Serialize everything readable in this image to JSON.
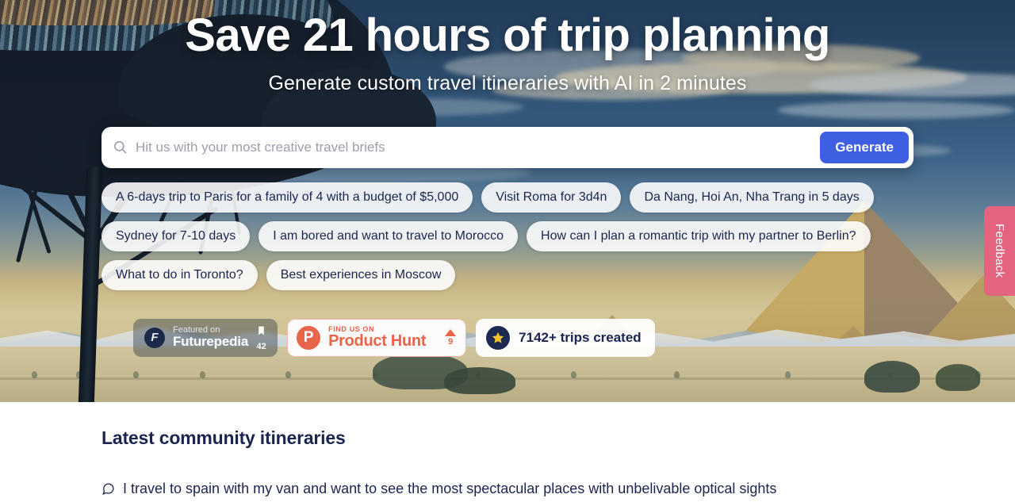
{
  "hero": {
    "title": "Save 21 hours of trip planning",
    "subtitle": "Generate custom travel itineraries with AI in 2 minutes",
    "search": {
      "placeholder": "Hit us with your most creative travel briefs",
      "value": "",
      "icon": "search-icon",
      "generate_label": "Generate"
    },
    "suggestions": [
      "A 6-days trip to Paris for a family of 4 with a budget of $5,000",
      "Visit Roma for 3d4n",
      "Da Nang, Hoi An, Nha Trang in 5 days",
      "Sydney for 7-10 days",
      "I am bored and want to travel to Morocco",
      "How can I plan a romantic trip with my partner to Berlin?",
      "What to do in Toronto?",
      "Best experiences in Moscow"
    ],
    "badges": {
      "futurepedia": {
        "logo_letter": "F",
        "featured_label": "Featured on",
        "name": "Futurepedia",
        "bookmark_icon": "bookmark-icon",
        "bookmark_count": "42"
      },
      "product_hunt": {
        "logo_letter": "P",
        "find_label": "FIND US ON",
        "name": "Product Hunt",
        "upvote_icon": "upvote-triangle-icon",
        "upvote_count": "9"
      },
      "trips": {
        "star_icon": "star-icon",
        "label": "7142+ trips created"
      }
    }
  },
  "feedback_tab": {
    "label": "Feedback"
  },
  "community": {
    "heading": "Latest community itineraries",
    "items": [
      {
        "icon": "chat-bubble-icon",
        "text": "I travel to spain with my van and want to see the most spectacular places with unbelivable optical sights"
      }
    ]
  },
  "colors": {
    "accent_blue": "#3f5fe2",
    "navy_text": "#1c2450",
    "feedback_pink": "#e4647f",
    "product_hunt_orange": "#e8654a",
    "star_yellow": "#f2c230",
    "sky_blue": "#2d4e6e",
    "sand": "#c6a964"
  }
}
